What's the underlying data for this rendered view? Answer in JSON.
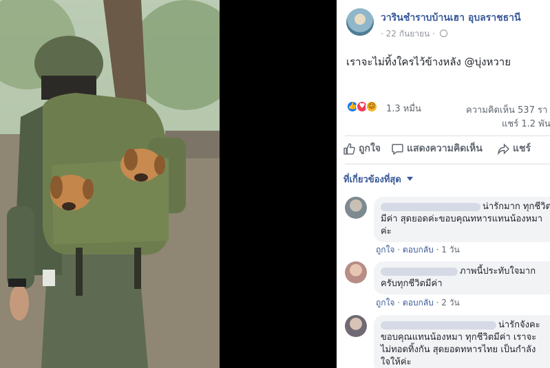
{
  "post": {
    "author": "วารินชำราบบ้านเฮา อุบลราชธานี",
    "date": "22 กันยายน",
    "date_prefix": "·",
    "date_sep": "·",
    "text": "เราจะไม่ทิ้งใครไว้ข้างหลัง @บุ่งหวาย",
    "photo_icon": "photo-soldier-puppies-backpack"
  },
  "stats": {
    "reactions_count": "1.3 หมื่น",
    "comments": "ความคิดเห็น 537 รา",
    "shares": "แชร์ 1.2 พัน",
    "reaction_icons": [
      "like-icon",
      "love-icon",
      "haha-icon"
    ]
  },
  "actions": {
    "like": "ถูกใจ",
    "comment": "แสดงความคิดเห็น",
    "share": "แชร์"
  },
  "sort": {
    "label": "ที่เกี่ยวข้องที่สุด",
    "icon": "caret-down-icon"
  },
  "comments": [
    {
      "lines": [
        "น่ารักมาก ทุกชีวิต",
        "มีค่า สุดยอดค่ะขอบคุณทหารแทนน้องหมา",
        "ค่ะ"
      ],
      "like": "ถูกใจ",
      "reply": "ตอบกลับ",
      "sep": "·",
      "time": "1 วัน"
    },
    {
      "lines": [
        "ภาพนี้ประทับใจมาก",
        "ครับทุกชีวิตมีค่า"
      ],
      "like": "ถูกใจ",
      "reply": "ตอบกลับ",
      "sep": "·",
      "time": "2 วัน"
    },
    {
      "lines": [
        "น่ารักจังคะ",
        "ขอบคุณแทนน้องหมา ทุกชีวิตมีค่า เราจะ",
        "ไม่ทอดทิ้งกัน สุดยอดทหารไทย เป็นกำลัง",
        "ใจให้ค่ะ"
      ]
    }
  ],
  "colors": {
    "link": "#385898",
    "like_blue": "#1877f2",
    "love_red": "#f33e58",
    "haha_yellow": "#f7b125"
  }
}
